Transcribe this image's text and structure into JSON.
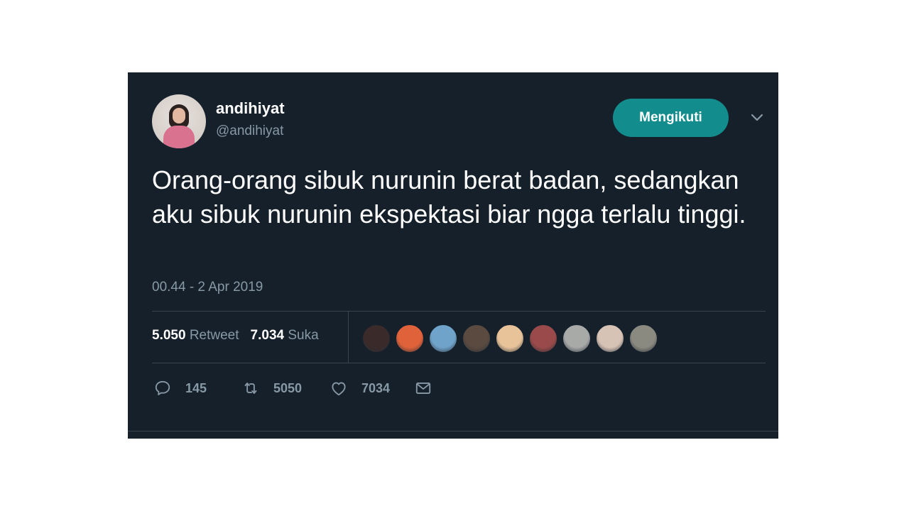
{
  "tweet": {
    "display_name": "andihiyat",
    "handle": "@andihiyat",
    "follow_label": "Mengikuti",
    "text": "Orang-orang sibuk nurunin berat badan, sedangkan aku sibuk nurunin ekspektasi biar ngga terlalu tinggi.",
    "timestamp": "00.44 - 2 Apr 2019"
  },
  "stats": {
    "retweets_count": "5.050",
    "retweets_label": "Retweet",
    "likes_count": "7.034",
    "likes_label": "Suka"
  },
  "liker_avatars": [
    {
      "color": "#3a2a2a"
    },
    {
      "color": "#e0623a"
    },
    {
      "color": "#6fa3c9"
    },
    {
      "color": "#5a4a40"
    },
    {
      "color": "#e8c39a"
    },
    {
      "color": "#9a4a4a"
    },
    {
      "color": "#a8aaa8"
    },
    {
      "color": "#d7c3b6"
    },
    {
      "color": "#8a8a80"
    }
  ],
  "actions": {
    "reply_count": "145",
    "retweet_count": "5050",
    "like_count": "7034"
  },
  "icons": {
    "reply": "reply-icon",
    "retweet": "retweet-icon",
    "like": "like-icon",
    "message": "message-icon",
    "chevron": "chevron-down-icon"
  },
  "colors": {
    "background": "#15202b",
    "accent": "#128c8c",
    "muted_text": "#8899a6",
    "divider": "#38444d"
  }
}
